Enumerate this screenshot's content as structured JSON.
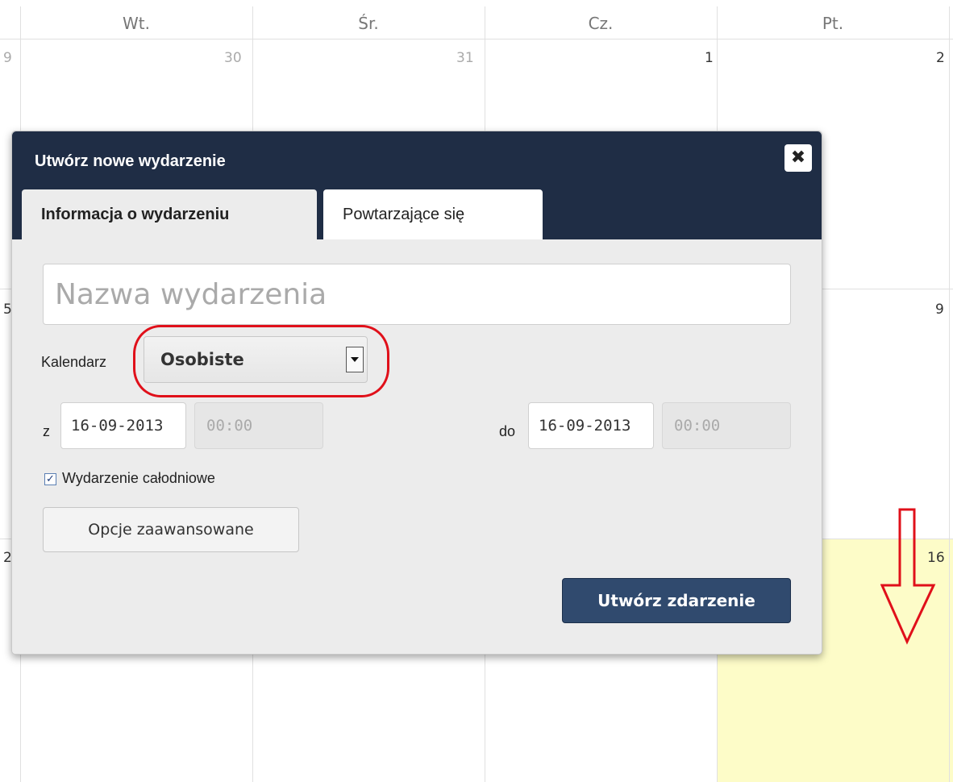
{
  "calendar": {
    "weekdays": [
      "Wt.",
      "Śr.",
      "Cz.",
      "Pt."
    ],
    "row1": {
      "left_partial": "9",
      "days": [
        "30",
        "31",
        "1",
        "2"
      ]
    },
    "row2": {
      "left_partial": "5",
      "last_day": "9"
    },
    "row3": {
      "left_partial": "2",
      "today": "16"
    },
    "colors": {
      "today_highlight": "#fdfcc8",
      "grid": "#e0e0e0"
    }
  },
  "modal": {
    "title": "Utwórz nowe wydarzenie",
    "close_icon": "close-icon",
    "tabs": [
      {
        "label": "Informacja o wydarzeniu",
        "active": true
      },
      {
        "label": "Powtarzające się",
        "active": false
      }
    ],
    "event_name_placeholder": "Nazwa wydarzenia",
    "calendar_label": "Kalendarz",
    "calendar_value": "Osobiste",
    "from_label": "z",
    "from_date": "16-09-2013",
    "from_time": "00:00",
    "to_label": "do",
    "to_date": "16-09-2013",
    "to_time": "00:00",
    "all_day_label": "Wydarzenie całodniowe",
    "all_day_checked": true,
    "advanced_button": "Opcje zaawansowane",
    "create_button": "Utwórz zdarzenie",
    "colors": {
      "header": "#1f2d45",
      "primary_button": "#304a6e",
      "annotation": "#e0101a"
    }
  }
}
